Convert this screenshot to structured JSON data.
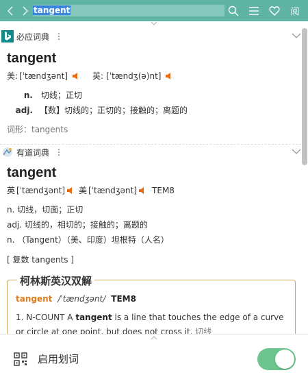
{
  "toolbar": {
    "search_value": "tangent",
    "back_icon": "chevron-left-icon",
    "forward_icon": "chevron-right-icon",
    "icons": [
      "search-icon",
      "menu-icon",
      "heart-icon",
      "book-icon"
    ],
    "book_glyph": "阅"
  },
  "bing": {
    "title": "必应词典",
    "more": "⋮",
    "headword": "tangent",
    "us_label": "美:",
    "us_phonetic": "[ˈtændʒənt]",
    "uk_label": "英:",
    "uk_phonetic": "[ˈtændʒ(ə)nt]",
    "defs": [
      {
        "pos": "n.",
        "text": "切线；正切"
      },
      {
        "pos": "adj.",
        "text": "【数】切线的；正切的；接触的；离题的"
      }
    ],
    "forms": "词形：tangents"
  },
  "youdao": {
    "title": "有道词典",
    "more": "⋮",
    "headword": "tangent",
    "phonetic_line": {
      "uk_label": "英",
      "uk_phonetic": "[ˈtændʒənt]",
      "us_label": "美",
      "us_phonetic": "[ˈtændʒənt]",
      "level": "TEM8"
    },
    "defs": [
      "n. 切线，切面；正切",
      "adj. 切线的，相切的；接触的；离题的",
      "n. （Tangent）（美、印度）坦根特（人名）"
    ],
    "plural": "[ 复数 tangents ]",
    "collins": {
      "title": "柯林斯英汉双解",
      "word": "tangent",
      "phonetic": "/ˈtændʒənt/",
      "level": "TEM8",
      "def_prefix": "1. N-COUNT A ",
      "def_word": "tangent",
      "def_rest": " is a line that touches the edge of a curve or circle at one point, but does not cross it.",
      "def_cn": "切线"
    }
  },
  "bottom": {
    "label": "启用划词",
    "toggle_on": true
  },
  "colors": {
    "topbar": "#5fb4a4",
    "accent_orange": "#e07b1c",
    "toggle_on": "#6cc48f"
  }
}
